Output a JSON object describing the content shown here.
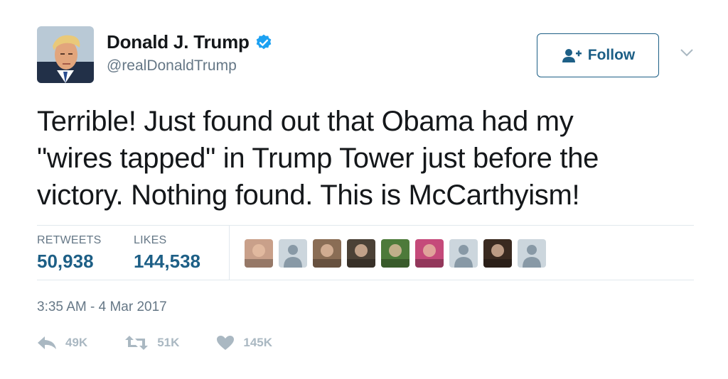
{
  "author": {
    "display_name": "Donald J. Trump",
    "handle": "@realDonaldTrump",
    "verified": true,
    "avatar": "profile-photo"
  },
  "follow": {
    "label": "Follow",
    "icon": "add-person-icon"
  },
  "menu_icon": "chevron-down-icon",
  "tweet": {
    "lines": [
      "Terrible! Just found out that Obama had my",
      "\"wires tapped\" in Trump Tower just before the",
      "victory. Nothing found. This is McCarthyism!"
    ]
  },
  "stats": {
    "retweets_label": "RETWEETS",
    "retweets_value": "50,938",
    "likes_label": "LIKES",
    "likes_value": "144,538"
  },
  "likers": [
    {
      "kind": "photo",
      "color": "#c9a08a"
    },
    {
      "kind": "default",
      "color": "#ccd6dd"
    },
    {
      "kind": "photo",
      "color": "#8a6d55"
    },
    {
      "kind": "photo",
      "color": "#4b4136"
    },
    {
      "kind": "photo",
      "color": "#4d7a3a"
    },
    {
      "kind": "photo",
      "color": "#c54a7a"
    },
    {
      "kind": "default",
      "color": "#ccd6dd"
    },
    {
      "kind": "photo",
      "color": "#3a2a20"
    },
    {
      "kind": "default",
      "color": "#ccd6dd"
    }
  ],
  "timestamp": "3:35 AM - 4 Mar 2017",
  "actions": {
    "reply_count": "49K",
    "retweet_count": "51K",
    "like_count": "145K"
  },
  "colors": {
    "link_blue": "#1d5f86",
    "verified_blue": "#1da1f2",
    "muted_gray": "#657786",
    "action_gray": "#aab8c2"
  }
}
